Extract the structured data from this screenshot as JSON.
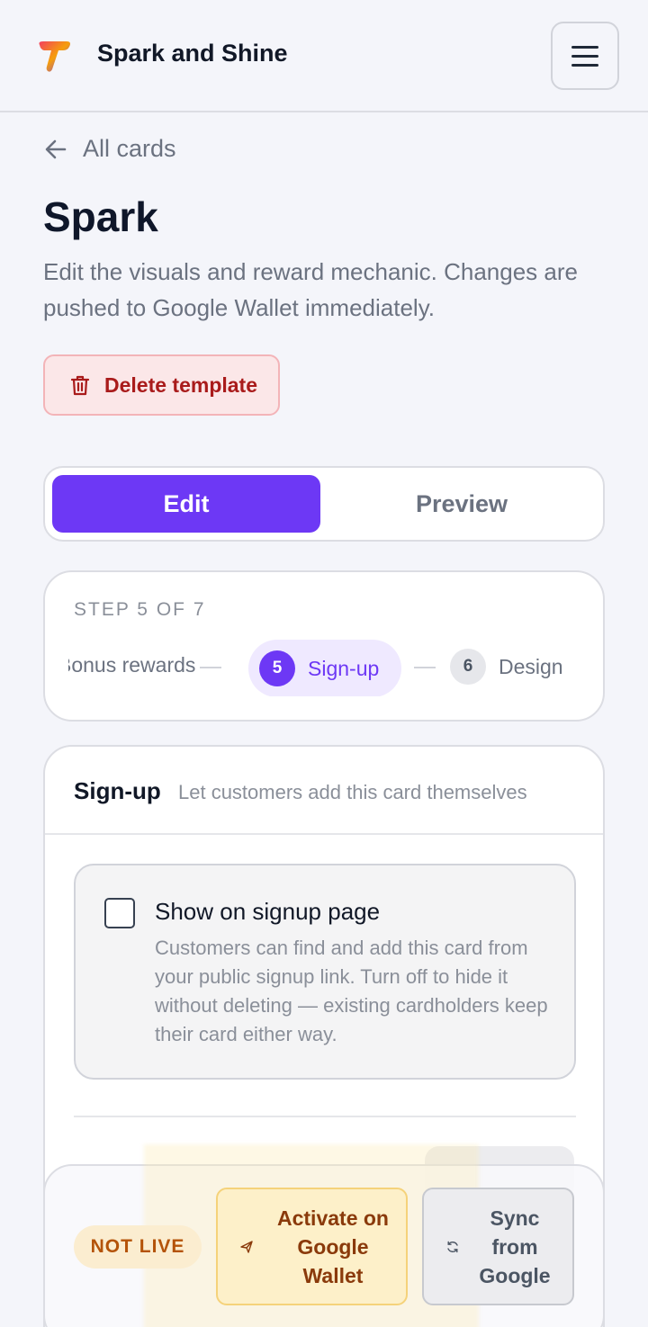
{
  "header": {
    "brand": "Spark and Shine",
    "logo_icon": "t-logo",
    "menu_icon": "hamburger-icon",
    "colors": {
      "logo_a": "#f43f5e",
      "logo_b": "#7c3aed",
      "logo_c": "#f59e0b"
    }
  },
  "nav": {
    "back_label": "All cards"
  },
  "page": {
    "title": "Spark",
    "subtitle": "Edit the visuals and reward mechanic. Changes are pushed to Google Wallet immediately.",
    "delete_label": "Delete template"
  },
  "mode": {
    "edit_label": "Edit",
    "preview_label": "Preview",
    "active": "Edit",
    "accent": "#6d38f5"
  },
  "steps": {
    "counter": "STEP 5 OF 7",
    "previous_label": "Bonus rewards",
    "current": {
      "number": "5",
      "label": "Sign-up"
    },
    "next": {
      "number": "6",
      "label": "Design"
    }
  },
  "section": {
    "title": "Sign-up",
    "description": "Let customers add this card themselves",
    "option": {
      "title": "Show on signup page",
      "checked": false,
      "description": "Customers can find and add this card from your public signup link. Turn off to hide it without deleting — existing cardholders keep their card either way."
    }
  },
  "footer": {
    "status": "NOT LIVE",
    "activate_label": "Activate on Google Wallet",
    "sync_label": "Sync from Google"
  }
}
